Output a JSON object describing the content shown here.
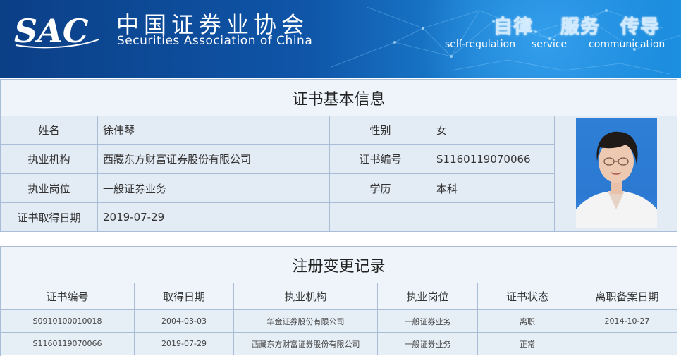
{
  "header": {
    "logo_text": "SAC",
    "org_name_cn": "中国证券业协会",
    "org_name_en": "Securities Association of China",
    "mottos": [
      {
        "cn": "自律",
        "en": "self-regulation"
      },
      {
        "cn": "服务",
        "en": "service"
      },
      {
        "cn": "传导",
        "en": "communication"
      }
    ]
  },
  "basic_info": {
    "title": "证书基本信息",
    "rows": [
      {
        "l1": "姓名",
        "v1": "徐伟琴",
        "l2": "性别",
        "v2": "女"
      },
      {
        "l1": "执业机构",
        "v1": "西藏东方财富证券股份有限公司",
        "l2": "证书编号",
        "v2": "S1160119070066"
      },
      {
        "l1": "执业岗位",
        "v1": "一般证券业务",
        "l2": "学历",
        "v2": "本科"
      },
      {
        "l1": "证书取得日期",
        "v1": "2019-07-29"
      }
    ],
    "photo_icon": "person-photo"
  },
  "change_records": {
    "title": "注册变更记录",
    "columns": [
      "证书编号",
      "取得日期",
      "执业机构",
      "执业岗位",
      "证书状态",
      "离职备案日期"
    ],
    "rows": [
      [
        "S0910100010018",
        "2004-03-03",
        "华金证券股份有限公司",
        "一般证券业务",
        "离职",
        "2014-10-27"
      ],
      [
        "S1160119070066",
        "2019-07-29",
        "西藏东方财富证券股份有限公司",
        "一般证券业务",
        "正常",
        ""
      ]
    ]
  }
}
